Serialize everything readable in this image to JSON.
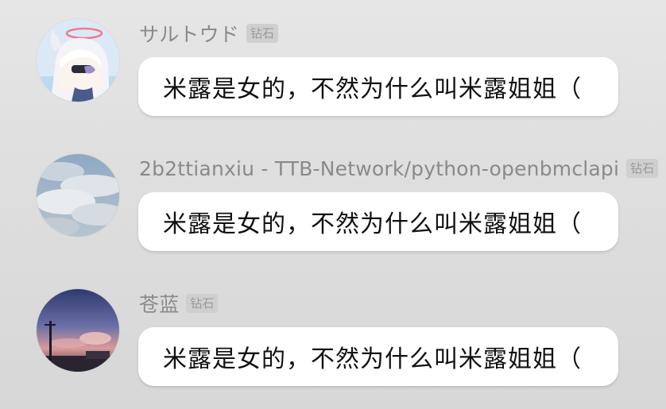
{
  "messages": [
    {
      "username": "サルトウド",
      "badge": "钻石",
      "avatar_icon": "anime-girl-avatar-icon",
      "text": "米露是女的，不然为什么叫米露姐姐（"
    },
    {
      "username": "2b2ttianxiu - TTB-Network/python-openbmclapi",
      "badge": "钻石",
      "avatar_icon": "cloudy-sky-avatar-icon",
      "text": "米露是女的，不然为什么叫米露姐姐（"
    },
    {
      "username": "苍蓝",
      "badge": "钻石",
      "avatar_icon": "sunset-sky-avatar-icon",
      "text": "米露是女的，不然为什么叫米露姐姐（"
    }
  ]
}
